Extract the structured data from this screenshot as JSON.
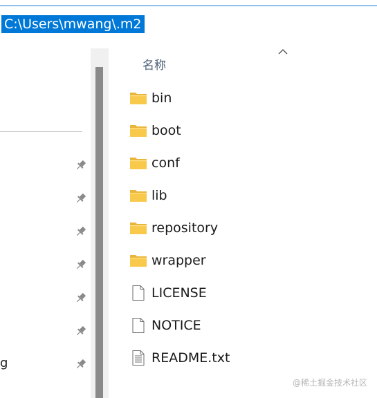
{
  "address_bar": {
    "path": "C:\\Users\\mwang\\.m2"
  },
  "nav_pane": {
    "pinned_count": 7,
    "truncated_label": "g"
  },
  "file_list": {
    "column_header": "名称",
    "items": [
      {
        "name": "bin",
        "type": "folder"
      },
      {
        "name": "boot",
        "type": "folder"
      },
      {
        "name": "conf",
        "type": "folder"
      },
      {
        "name": "lib",
        "type": "folder"
      },
      {
        "name": "repository",
        "type": "folder"
      },
      {
        "name": "wrapper",
        "type": "folder"
      },
      {
        "name": "LICENSE",
        "type": "file"
      },
      {
        "name": "NOTICE",
        "type": "file"
      },
      {
        "name": "README.txt",
        "type": "text-file"
      }
    ]
  },
  "watermark": "@稀土掘金技术社区",
  "colors": {
    "selection": "#0078d7",
    "folder": "#f8c94b",
    "header_text": "#4c607a"
  }
}
